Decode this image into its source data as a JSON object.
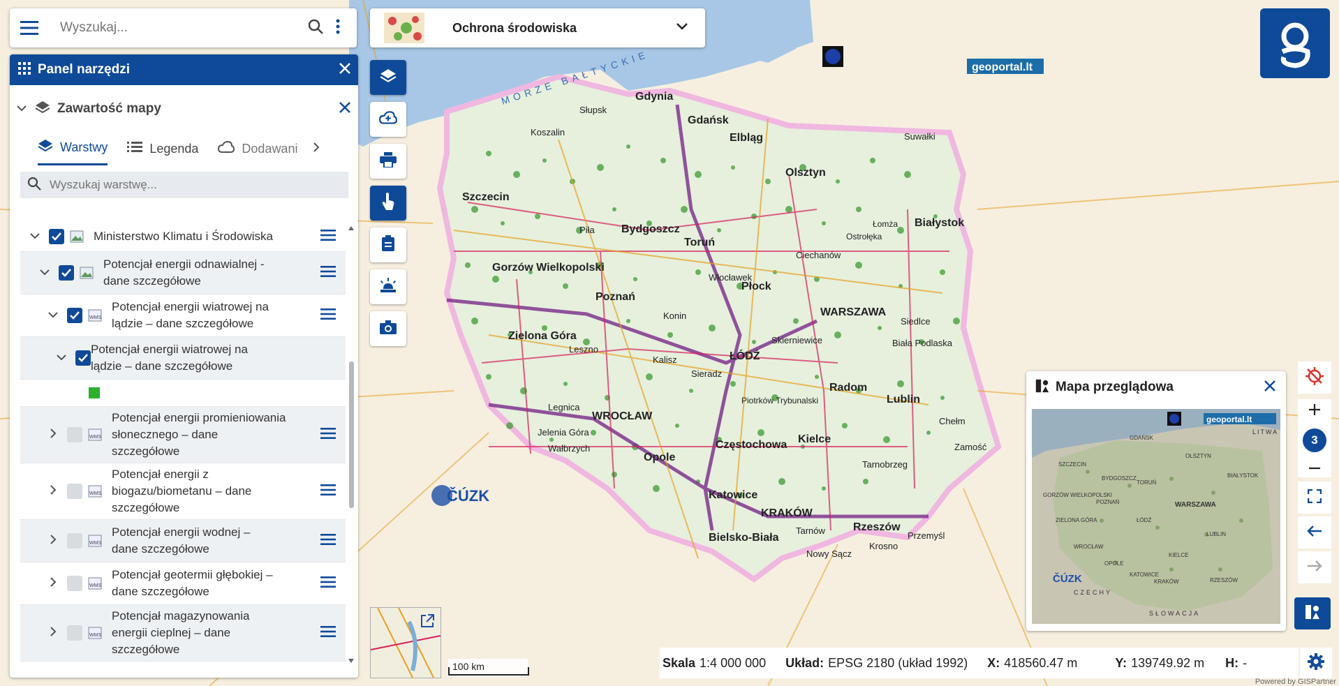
{
  "search": {
    "placeholder": "Wyszukaj..."
  },
  "topic": {
    "title": "Ochrona środowiska"
  },
  "panel": {
    "title": "Panel narzędzi",
    "content_title": "Zawartość mapy",
    "tabs": [
      {
        "label": "Warstwy",
        "icon": "layers-icon"
      },
      {
        "label": "Legenda",
        "icon": "list-icon"
      },
      {
        "label": "Dodawani",
        "icon": "cloud-add-icon"
      }
    ],
    "layer_search_placeholder": "Wyszukaj warstwę...",
    "tree": [
      {
        "label": "Ministerstwo Klimatu i Środowiska",
        "checked": true
      },
      {
        "label": "Potencjał energii odnawialnej - dane szczegółowe",
        "checked": true
      },
      {
        "label": "Potencjał energii wiatrowej na lądzie – dane szczegółowe",
        "checked": true
      },
      {
        "label": "Potencjał energii wiatrowej na lądzie – dane szczegółowe",
        "checked": true
      },
      {
        "label": "Potencjał energii promieniowania słonecznego – dane szczegółowe",
        "checked": false
      },
      {
        "label": "Potencjał energii z biogazu/biometanu – dane szczegółowe",
        "checked": false
      },
      {
        "label": "Potencjał energii wodnej – dane szczegółowe",
        "checked": false
      },
      {
        "label": "Potencjał geotermii głębokiej – dane szczegółowe",
        "checked": false
      },
      {
        "label": "Potencjał magazynowania energii cieplnej – dane szczegółowe",
        "checked": false
      }
    ],
    "legend_color": "#2db02d"
  },
  "map": {
    "sea_label": "MORZE BAŁTYCKIE",
    "cities": [
      "Gdynia",
      "Gdańsk",
      "Elbląg",
      "Słupsk",
      "Koszalin",
      "Olsztyn",
      "Suwałki",
      "Szczecin",
      "Bydgoszcz",
      "Toruń",
      "Białystok",
      "Piła",
      "Gorzów Wielkopolski",
      "Ostrołęka",
      "Łomża",
      "Ciechanów",
      "Włocławek",
      "Płock",
      "Poznań",
      "Konin",
      "WARSZAWA",
      "Siedlce",
      "Biała Podlaska",
      "Zielona Góra",
      "Leszno",
      "Kalisz",
      "ŁÓDŹ",
      "Skierniewice",
      "Sieradz",
      "Radom",
      "Lublin",
      "Piotrków Trybunalski",
      "WROCŁAW",
      "Legnica",
      "Jelenia Góra",
      "Wałbrzych",
      "Opole",
      "Częstochowa",
      "Kielce",
      "Chełm",
      "Zamość",
      "Tarnobrzeg",
      "Katowice",
      "KRAKÓW",
      "Rzeszów",
      "Przemyśl",
      "Bielsko-Biała",
      "Tarnów",
      "Krosno",
      "Nowy Sącz"
    ],
    "scale_bar": "100 km",
    "geoportal_lt": "geoportal.lt",
    "cuzk": "ČÚZK"
  },
  "overview": {
    "title": "Mapa przeglądowa",
    "labels": [
      "SZCZECIN",
      "GDAŃSK",
      "OLSZTYN",
      "BYDGOSZCZ",
      "TORUŃ",
      "BIAŁYSTOK",
      "GORZÓW WIELKOPOLSKI",
      "POZNAŃ",
      "WARSZAWA",
      "ZIELONA GÓRA",
      "ŁÓDŹ",
      "LUBLIN",
      "WROCŁAW",
      "OPOLE",
      "KIELCE",
      "KATOWICE",
      "KRAKÓW",
      "RZESZÓW",
      "CZECHY",
      "SŁOWACJA",
      "LITWA",
      "ČÚZK",
      "geoportal.lt"
    ]
  },
  "zoom": {
    "level": "3"
  },
  "status": {
    "scale_label": "Skala",
    "scale_value": "1:4 000 000",
    "crs_label": "Układ:",
    "crs_value": "EPSG 2180 (układ 1992)",
    "x_label": "X:",
    "x_value": "418560.47 m",
    "y_label": "Y:",
    "y_value": "139749.92 m",
    "h_label": "H:",
    "h_value": "-"
  },
  "powered": "Powered by GISPartner",
  "colors": {
    "primary": "#0f4a98",
    "poland_fill": "#e9f1e2",
    "green_dots": "#3a9a2e",
    "roads": "#d81e5b",
    "motorway": "#7a2a8a"
  }
}
